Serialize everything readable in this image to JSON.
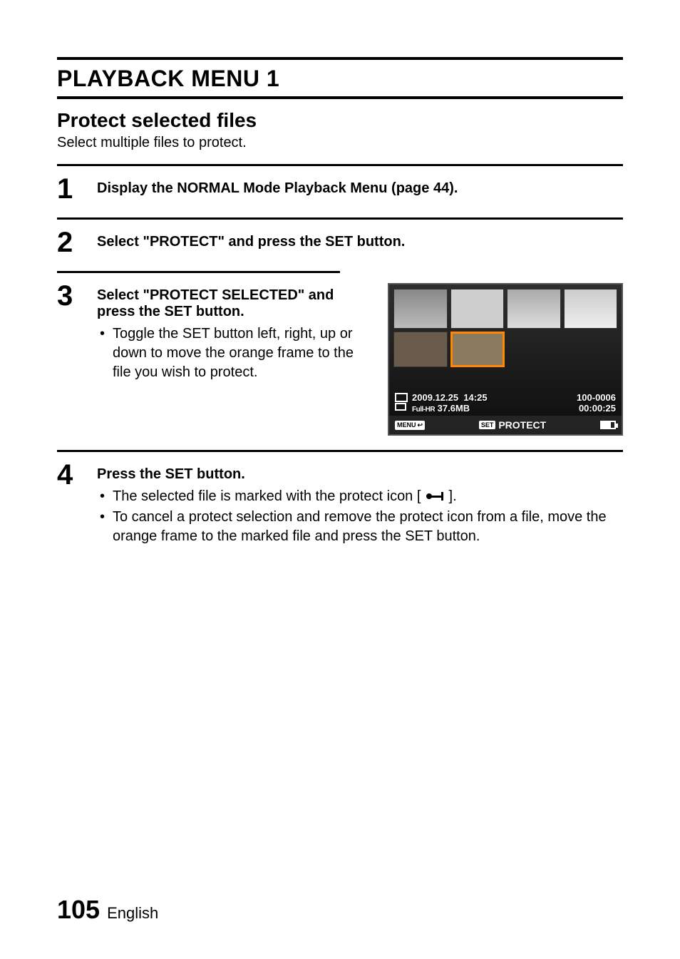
{
  "header": {
    "title": "PLAYBACK MENU 1"
  },
  "section": {
    "title": "Protect selected files",
    "desc": "Select multiple files to protect."
  },
  "steps": {
    "s1": {
      "num": "1",
      "text": "Display the NORMAL Mode Playback Menu (page 44)."
    },
    "s2": {
      "num": "2",
      "text": "Select \"PROTECT\" and press the SET button."
    },
    "s3": {
      "num": "3",
      "text": "Select \"PROTECT SELECTED\" and press the SET button.",
      "bullet1": "Toggle the SET button left, right, up or down to move the orange frame to the file you wish to protect."
    },
    "s4": {
      "num": "4",
      "text": "Press the SET button.",
      "bullet1_pre": "The selected file is marked with the protect icon [",
      "bullet1_post": "].",
      "bullet2": "To cancel a protect selection and remove the protect icon from a file, move the orange frame to the marked file and press the SET button."
    }
  },
  "screenshot": {
    "date": "2009.12.25",
    "time": "14:25",
    "mode": "Full-HR",
    "size": "37.6MB",
    "file_no": "100-0006",
    "duration": "00:00:25",
    "menu_label": "MENU",
    "set_label": "SET",
    "protect_label": "PROTECT"
  },
  "footer": {
    "page": "105",
    "lang": "English"
  }
}
